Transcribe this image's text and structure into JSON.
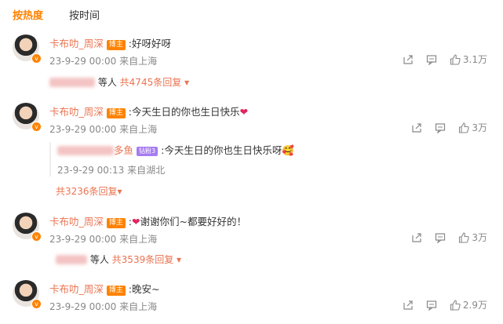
{
  "tabs": {
    "hot": "按热度",
    "time": "按时间"
  },
  "comments": [
    {
      "user": "卡布叻_周深",
      "badge": "博主",
      "text": ":好呀好呀",
      "date": "23-9-29 00:00",
      "location": "来自上海",
      "likes": "3.1万",
      "reply_users_suffix": "等人",
      "reply_count": "共4745条回复"
    },
    {
      "user": "卡布叻_周深",
      "badge": "博主",
      "text": ":今天生日的你也生日快乐",
      "emoji": "❤",
      "date": "23-9-29 00:00",
      "location": "来自上海",
      "likes": "3万",
      "sub": {
        "user_suffix": "多鱼",
        "badge": "钻粉3",
        "text": ":今天生日的你也生日快乐呀",
        "emoji": "🥰",
        "date": "23-9-29 00:13",
        "location": "来自湖北"
      },
      "reply_count": "共3236条回复"
    },
    {
      "user": "卡布叻_周深",
      "badge": "博主",
      "emoji": "❤",
      "text": "谢谢你们~都要好好的！",
      "date": "23-9-29 00:00",
      "location": "来自上海",
      "likes": "3万",
      "reply_users_suffix": "等人",
      "reply_count": "共3539条回复"
    },
    {
      "user": "卡布叻_周深",
      "badge": "博主",
      "text": ":晚安~",
      "date": "23-9-29 00:00",
      "location": "来自上海",
      "likes": "2.9万"
    }
  ]
}
